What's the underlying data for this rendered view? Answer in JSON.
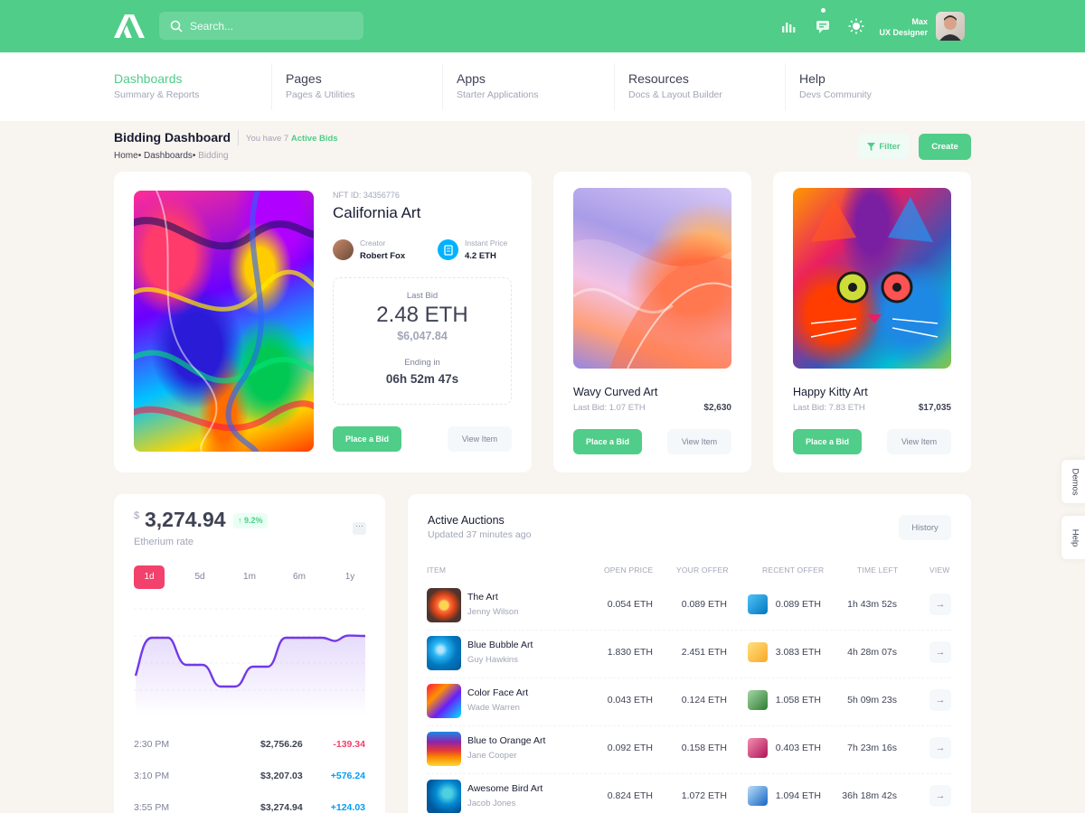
{
  "header": {
    "search_placeholder": "Search...",
    "user_name": "Max",
    "user_role": "UX Designer"
  },
  "nav": [
    {
      "title": "Dashboards",
      "sub": "Summary & Reports"
    },
    {
      "title": "Pages",
      "sub": "Pages & Utilities"
    },
    {
      "title": "Apps",
      "sub": "Starter Applications"
    },
    {
      "title": "Resources",
      "sub": "Docs & Layout Builder"
    },
    {
      "title": "Help",
      "sub": "Devs Community"
    }
  ],
  "toolbar": {
    "title": "Bidding Dashboard",
    "sub_prefix": "You have 7",
    "sub_highlight": "Active Bids",
    "crumbs": [
      "Home",
      "Dashboards",
      "Bidding"
    ],
    "filter_label": "Filter",
    "create_label": "Create"
  },
  "featured": {
    "nft_id": "NFT ID: 34356776",
    "title": "California Art",
    "creator_label": "Creator",
    "creator_name": "Robert Fox",
    "instant_label": "Instant Price",
    "instant_value": "4.2 ETH",
    "last_bid_label": "Last Bid",
    "last_bid_eth": "2.48 ETH",
    "last_bid_usd": "$6,047.84",
    "ending_label": "Ending in",
    "ending_value": "06h 52m 47s",
    "place_bid": "Place a Bid",
    "view_item": "View Item"
  },
  "cards": [
    {
      "title": "Wavy Curved Art",
      "last_bid": "Last Bid: 1.07 ETH",
      "price": "$2,630",
      "place_bid": "Place a Bid",
      "view_item": "View Item"
    },
    {
      "title": "Happy Kitty Art",
      "last_bid": "Last Bid: 7.83 ETH",
      "price": "$17,035",
      "place_bid": "Place a Bid",
      "view_item": "View Item"
    }
  ],
  "rate": {
    "currency": "$",
    "value": "3,274.94",
    "change": "9.2%",
    "label": "Etherium rate",
    "menu": "···",
    "tabs": [
      "1d",
      "5d",
      "1m",
      "6m",
      "1y"
    ],
    "rows": [
      {
        "time": "2:30 PM",
        "price": "$2,756.26",
        "change": "-139.34"
      },
      {
        "time": "3:10 PM",
        "price": "$3,207.03",
        "change": "+576.24"
      },
      {
        "time": "3:55 PM",
        "price": "$3,274.94",
        "change": "+124.03"
      }
    ]
  },
  "auctions": {
    "title": "Active Auctions",
    "updated": "Updated 37 minutes ago",
    "history_label": "History",
    "headers": [
      "ITEM",
      "OPEN PRICE",
      "YOUR OFFER",
      "RECENT OFFER",
      "TIME LEFT",
      "VIEW"
    ],
    "rows": [
      {
        "name": "The Art",
        "author": "Jenny Wilson",
        "open": "0.054 ETH",
        "offer": "0.089 ETH",
        "recent": "0.089 ETH",
        "time": "1h 43m 52s"
      },
      {
        "name": "Blue Bubble Art",
        "author": "Guy Hawkins",
        "open": "1.830 ETH",
        "offer": "2.451 ETH",
        "recent": "3.083 ETH",
        "time": "4h 28m 07s"
      },
      {
        "name": "Color Face Art",
        "author": "Wade Warren",
        "open": "0.043 ETH",
        "offer": "0.124 ETH",
        "recent": "1.058 ETH",
        "time": "5h 09m 23s"
      },
      {
        "name": "Blue to Orange Art",
        "author": "Jane Cooper",
        "open": "0.092 ETH",
        "offer": "0.158 ETH",
        "recent": "0.403 ETH",
        "time": "7h 23m 16s"
      },
      {
        "name": "Awesome Bird Art",
        "author": "Jacob Jones",
        "open": "0.824 ETH",
        "offer": "1.072 ETH",
        "recent": "1.094 ETH",
        "time": "36h 18m 42s"
      }
    ],
    "view_glyph": "→"
  },
  "side": {
    "demos": "Demos",
    "help": "Help"
  },
  "colors": {
    "primary": "#50cd89",
    "danger": "#f1416c",
    "info": "#009ef7",
    "chart": "#7239ea"
  }
}
